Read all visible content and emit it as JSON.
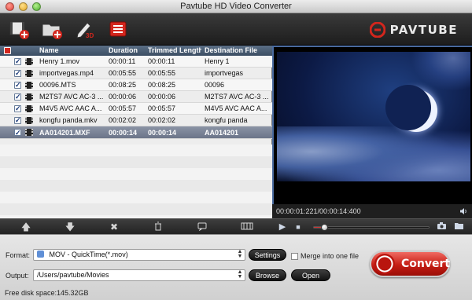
{
  "window": {
    "title": "Pavtube HD Video Converter"
  },
  "toolbar": {
    "buttons": [
      {
        "icon": "add-video-icon"
      },
      {
        "icon": "add-folder-icon"
      },
      {
        "icon": "edit-icon"
      },
      {
        "icon": "task-list-icon"
      }
    ],
    "logo_text": "PAVTUBE"
  },
  "file_list": {
    "columns": [
      "Name",
      "Duration",
      "Trimmed Length",
      "Destination File"
    ],
    "rows": [
      {
        "name": "Henry 1.mov",
        "duration": "00:00:11",
        "trimmed": "00:00:11",
        "dest": "Henry 1",
        "checked": true,
        "selected": false
      },
      {
        "name": "importvegas.mp4",
        "duration": "00:05:55",
        "trimmed": "00:05:55",
        "dest": "importvegas",
        "checked": true,
        "selected": false
      },
      {
        "name": "00096.MTS",
        "duration": "00:08:25",
        "trimmed": "00:08:25",
        "dest": "00096",
        "checked": true,
        "selected": false
      },
      {
        "name": "M2TS7 AVC AC-3 ...",
        "duration": "00:00:06",
        "trimmed": "00:00:06",
        "dest": "M2TS7 AVC AC-3 ...",
        "checked": true,
        "selected": false
      },
      {
        "name": "M4V5 AVC AAC A...",
        "duration": "00:05:57",
        "trimmed": "00:05:57",
        "dest": "M4V5 AVC AAC A...",
        "checked": true,
        "selected": false
      },
      {
        "name": "kongfu panda.mkv",
        "duration": "00:02:02",
        "trimmed": "00:02:02",
        "dest": "kongfu panda",
        "checked": true,
        "selected": false
      },
      {
        "name": "AA014201.MXF",
        "duration": "00:00:14",
        "trimmed": "00:00:14",
        "dest": "AA014201",
        "checked": true,
        "selected": true
      }
    ]
  },
  "preview": {
    "time_readout": "00:00:01:221/00:00:14:400",
    "progress": 0.09
  },
  "bottom": {
    "format_label": "Format:",
    "format_value": "MOV - QuickTime(*.mov)",
    "settings_label": "Settings",
    "merge_label": "Merge into one file",
    "output_label": "Output:",
    "output_value": "/Users/pavtube/Movies",
    "browse_label": "Browse",
    "open_label": "Open",
    "convert_label": "Convert",
    "status": "Free disk space:145.32GB"
  }
}
